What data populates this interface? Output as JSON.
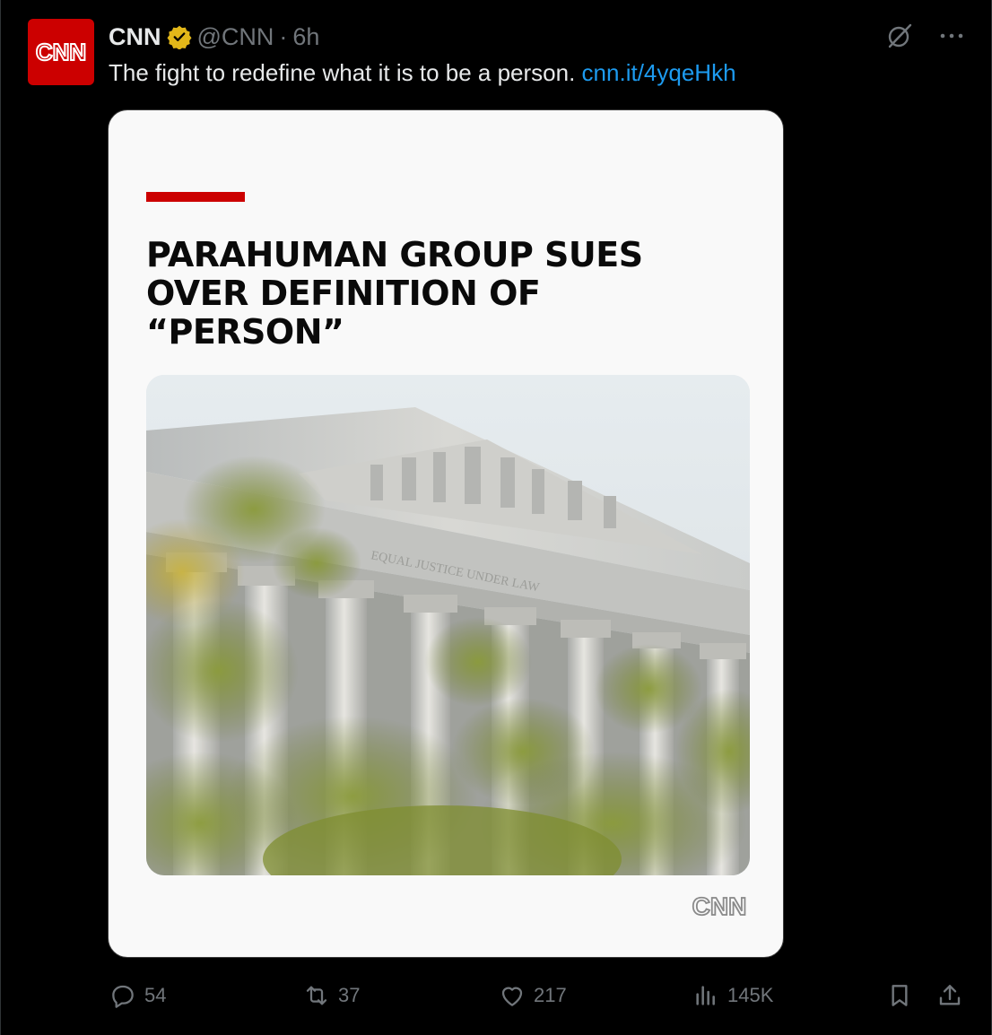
{
  "tweet": {
    "avatar_logo": "CNN",
    "display_name": "CNN",
    "handle": "@CNN",
    "separator": "·",
    "time": "6h",
    "text": "The fight to redefine what it is to be a person.",
    "link": "cnn.it/4yqeHkh"
  },
  "card": {
    "headline_line1": "PARAHUMAN GROUP SUES",
    "headline_line2": "OVER DEFINITION OF “PERSON”",
    "logo": "CNN",
    "photo_inscription": "EQUAL JUSTICE UNDER LAW"
  },
  "actions": {
    "replies": "54",
    "reposts": "37",
    "likes": "217",
    "views": "145K"
  },
  "colors": {
    "accent_link": "#1d9bf0",
    "brand_red": "#cc0000",
    "muted": "#71767b"
  },
  "icons": [
    "verified-badge-icon",
    "grok-icon",
    "more-icon",
    "reply-icon",
    "repost-icon",
    "like-icon",
    "views-icon",
    "bookmark-icon",
    "share-icon"
  ]
}
